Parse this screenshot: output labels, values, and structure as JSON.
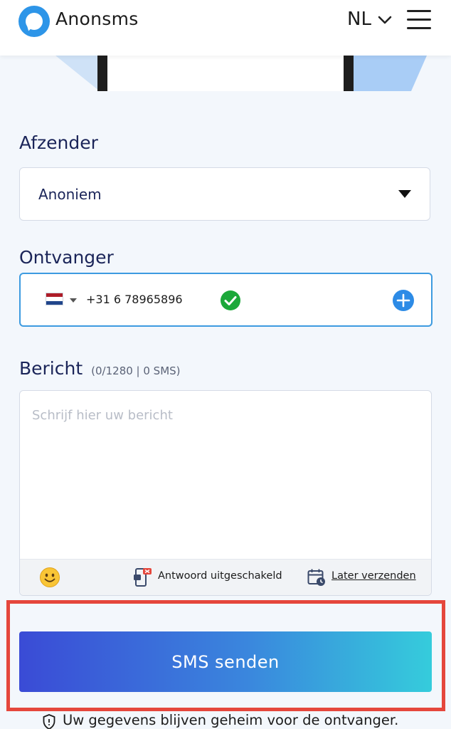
{
  "header": {
    "brand": "Anonsms",
    "language": "NL",
    "icons": {
      "logo": "chat-bubble-logo",
      "language_toggle": "chevron-down-icon",
      "menu": "hamburger-menu-icon"
    }
  },
  "form": {
    "sender": {
      "label": "Afzender",
      "selected": "Anoniem"
    },
    "recipient": {
      "label": "Ontvanger",
      "country_flag": "Netherlands",
      "phone": "+31 6 78965896",
      "status": "valid"
    },
    "message": {
      "label": "Bericht",
      "counter": "(0/1280 | 0 SMS)",
      "placeholder": "Schrijf hier uw bericht",
      "value": "",
      "reply_status": "Antwoord uitgeschakeld",
      "schedule_link": "Later verzenden"
    },
    "send_button": "SMS senden",
    "privacy_note": "Uw gegevens blijven geheim voor de ontvanger."
  },
  "colors": {
    "accent_blue": "#3d9be0",
    "check_green": "#1ca83a",
    "highlight_red": "#e5473c",
    "button_gradient_start": "#3a4bd6",
    "button_gradient_end": "#35ccdc"
  }
}
